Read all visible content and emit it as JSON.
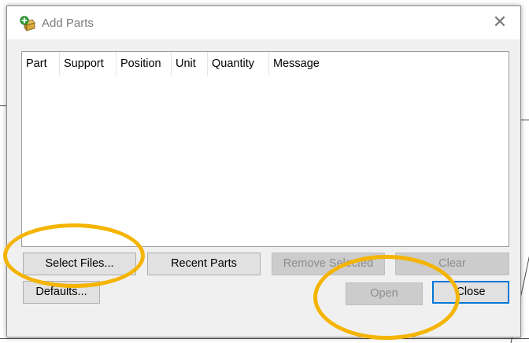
{
  "window": {
    "title": "Add Parts",
    "icon": "add-parts-icon",
    "close_icon": "close-icon"
  },
  "list": {
    "columns": [
      "Part",
      "Support",
      "Position",
      "Unit",
      "Quantity",
      "Message"
    ],
    "rows": []
  },
  "buttons": {
    "select_files": "Select Files...",
    "recent_parts": "Recent Parts",
    "remove_selected": "Remove Selected",
    "clear": "Clear",
    "defaults": "Defaults...",
    "open": "Open",
    "close": "Close"
  },
  "colors": {
    "highlight": "#f4b400",
    "dialog_bg": "#f0f0f0",
    "button_bg": "#e1e1e1",
    "disabled_text": "#8d8d8d",
    "focus_border": "#0078d7"
  }
}
